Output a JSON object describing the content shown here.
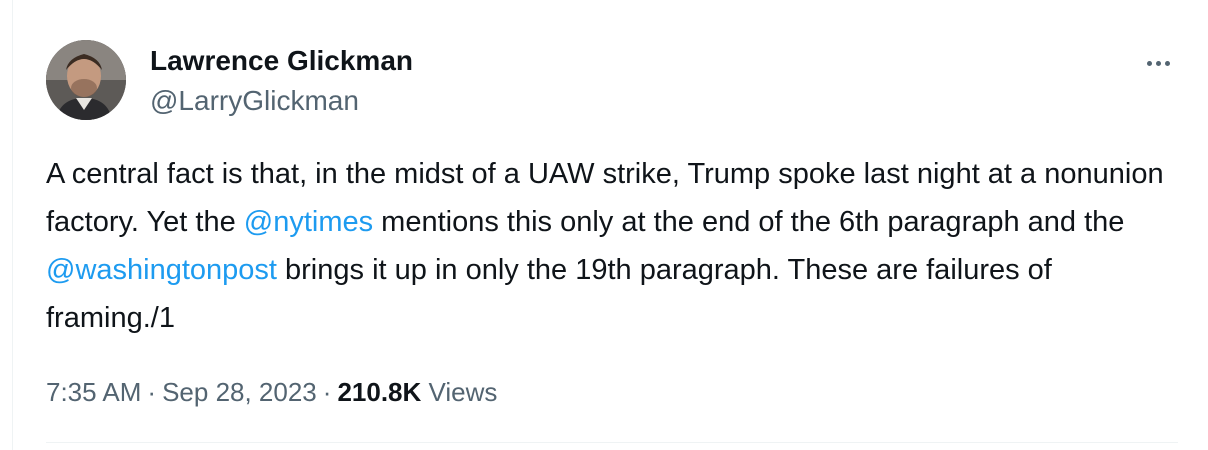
{
  "author": {
    "name": "Lawrence Glickman",
    "handle": "@LarryGlickman"
  },
  "tweet": {
    "text_1": "A central fact is that, in the midst of a UAW strike, Trump spoke last night at a nonunion factory. Yet the ",
    "mention_1": "@nytimes",
    "text_2": " mentions this only at the end of the 6th paragraph and the ",
    "mention_2": "@washingtonpost",
    "text_3": " brings it up in only the 19th paragraph. These are failures of framing./1"
  },
  "meta": {
    "time": "7:35 AM",
    "separator": "·",
    "date": "Sep 28, 2023",
    "views_count": "210.8K",
    "views_label": "Views"
  },
  "colors": {
    "text": "#0f1419",
    "secondary": "#536471",
    "link": "#1d9bf0",
    "divider": "#eff3f4"
  },
  "icons": {
    "more": "more-horizontal-icon"
  }
}
